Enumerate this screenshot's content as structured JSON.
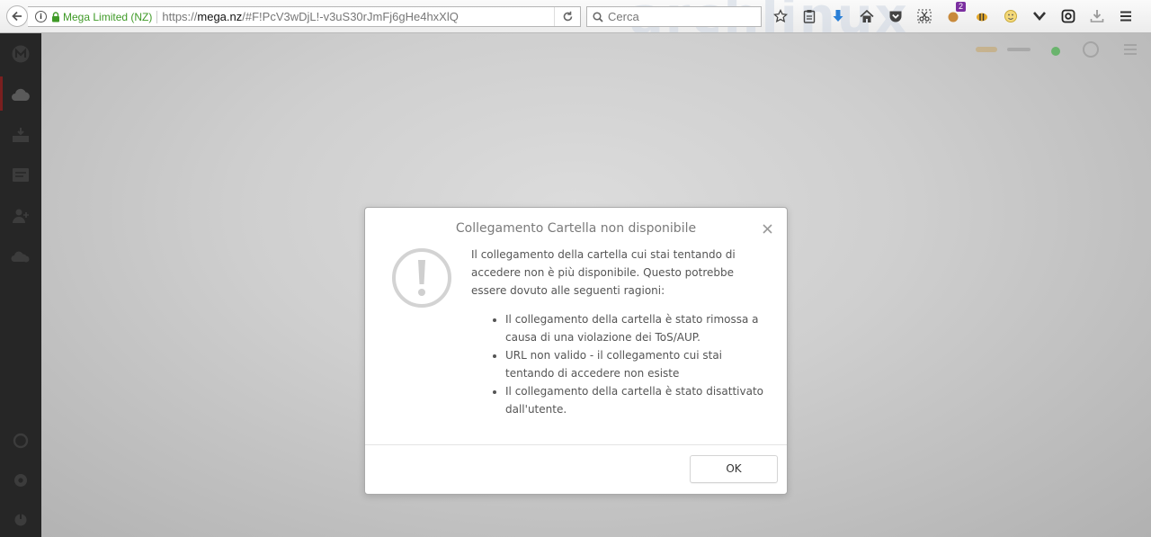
{
  "browser": {
    "site_identity": "Mega Limited (NZ)",
    "url_scheme": "https://",
    "url_host": "mega.nz",
    "url_path": "/#F!PcV3wDjL!-v3uS30rJmFj6gHe4hxXlQ",
    "search_placeholder": "Cerca",
    "watermark_text": "archlinux",
    "notification_badge": "2",
    "colors": {
      "identity_green": "#3f9a27",
      "download_blue": "#2a7fd6",
      "badge_purple": "#7b2fa0"
    }
  },
  "app": {
    "sidebar_icons": [
      "mega-logo-icon",
      "cloud-drive-icon",
      "inbox-icon",
      "chat-icon",
      "contacts-icon",
      "shared-icon",
      "sync-icon",
      "settings-icon",
      "logout-icon"
    ],
    "status_color": "#4caf50"
  },
  "dialog": {
    "title": "Collegamento Cartella non disponibile",
    "message": "Il collegamento della cartella cui stai tentando di accedere non è più disponibile. Questo potrebbe essere dovuto alle seguenti ragioni:",
    "reasons": [
      "Il collegamento della cartella è stato rimossa a causa di una violazione dei ToS/AUP.",
      "URL non valido - il collegamento cui stai tentando di accedere non esiste",
      "Il collegamento della cartella è stato disattivato dall'utente."
    ],
    "ok_label": "OK",
    "icon": "exclamation-circle-icon"
  }
}
